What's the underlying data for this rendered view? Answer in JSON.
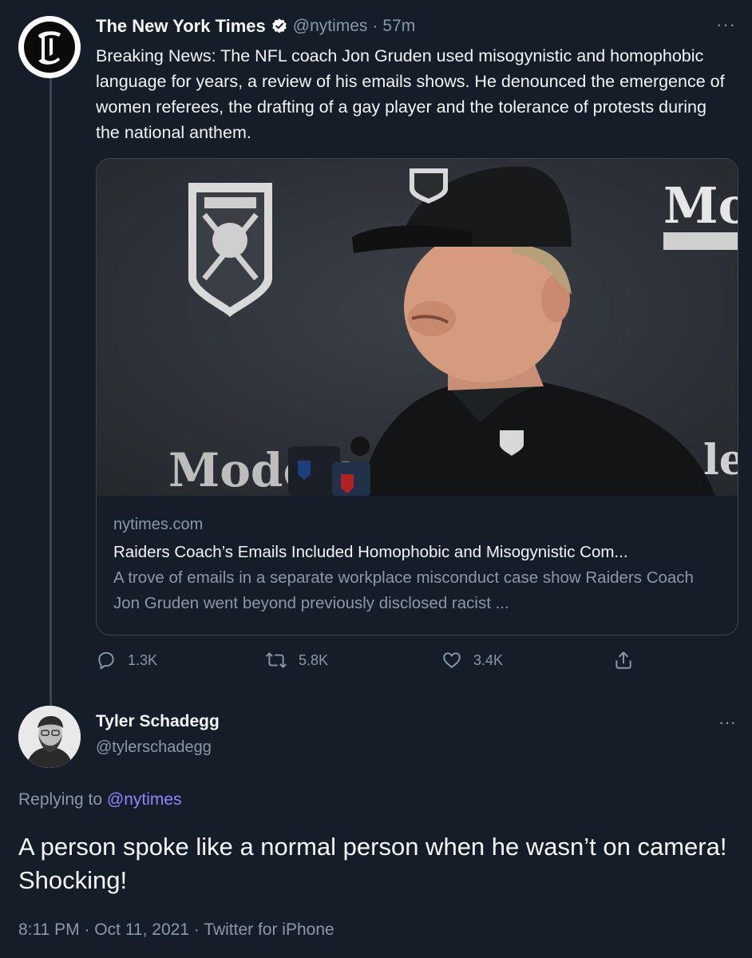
{
  "tweet1": {
    "name": "The New York Times",
    "handle": "@nytimes",
    "separator": "·",
    "time": "57m",
    "text": "Breaking News: The NFL coach Jon Gruden used misogynistic and homophobic language for years, a review of his emails shows. He denounced the emergence of women referees, the drafting of a gay player and the tolerance of protests during the national anthem.",
    "avatar_glyph": "𝕿",
    "card": {
      "domain": "nytimes.com",
      "title": "Raiders Coach’s Emails Included Homophobic and Misogynistic Com...",
      "description": "A trove of emails in a separate workplace misconduct case show Raiders Coach Jon Gruden went beyond previously disclosed racist ..."
    },
    "actions": {
      "replies": "1.3K",
      "retweets": "5.8K",
      "likes": "3.4K"
    },
    "more": "···"
  },
  "tweet2": {
    "name": "Tyler Schadegg",
    "handle": "@tylerschadegg",
    "replying_prefix": "Replying to ",
    "replying_to": "@nytimes",
    "text": "A person spoke like a normal person when he wasn’t on camera! Shocking!",
    "meta": "8:11 PM · Oct 11, 2021 · Twitter for iPhone",
    "more": "···"
  },
  "colors": {
    "background": "#151d29",
    "secondary_text": "#8a98a8",
    "link": "#8f86ff",
    "verified": "#ffffff"
  }
}
